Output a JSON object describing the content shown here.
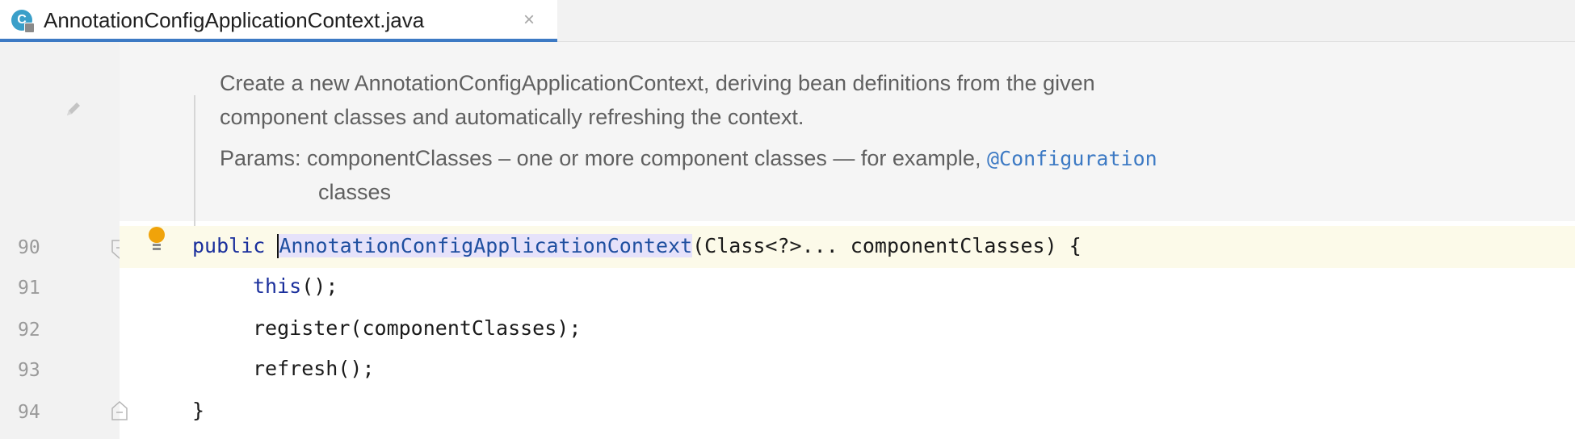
{
  "tab": {
    "icon": "class-c-icon",
    "icon_letter": "C",
    "filename": "AnnotationConfigApplicationContext.java",
    "close_glyph": "×"
  },
  "doc": {
    "line1": "Create a new AnnotationConfigApplicationContext, deriving bean definitions from the given",
    "line2": "component classes and automatically refreshing the context.",
    "params_label": "Params:",
    "params_text": "componentClasses – one or more component classes — for example,",
    "params_annotation": "@Configuration",
    "params_cont": "classes"
  },
  "gutter": {
    "line_numbers": [
      "90",
      "91",
      "92",
      "93",
      "94"
    ]
  },
  "code": {
    "l90_kw": "public",
    "l90_name": "AnnotationConfigApplicationContext",
    "l90_rest": "(Class<?>... componentClasses) {",
    "l91_kw": "this",
    "l91_rest": "();",
    "l92": "register(componentClasses);",
    "l93": "refresh();",
    "l94": "}"
  },
  "colors": {
    "keyword": "#1a2f9c",
    "annotation": "#3d7ac4",
    "tab_underline": "#3d7ac4",
    "current_line": "#fcfae9"
  }
}
